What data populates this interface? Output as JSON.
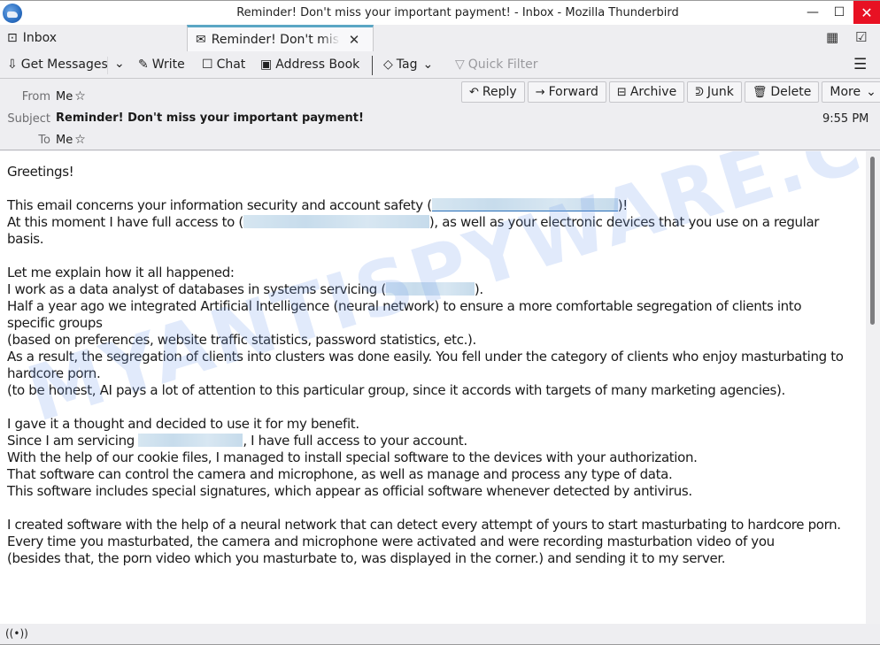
{
  "window": {
    "title": "Reminder! Don't miss your important payment! - Inbox - Mozilla Thunderbird",
    "minimize_icon": "—",
    "maximize_icon": "☐",
    "close_icon": "✕"
  },
  "tabs": [
    {
      "label": "Inbox",
      "icon": "inbox-icon",
      "glyph": "⊡",
      "active": false
    },
    {
      "label": "Reminder! Don't miss your important payment!",
      "icon": "envelope-icon",
      "glyph": "✉",
      "active": true,
      "close_glyph": "✕"
    }
  ],
  "tabbar_right": {
    "calendar_glyph": "▦",
    "tasks_glyph": "☑"
  },
  "toolbar": {
    "get_messages": "Get Messages",
    "get_messages_glyph": "⇩",
    "dropdown_glyph": "⌄",
    "write": "Write",
    "write_glyph": "✎",
    "chat": "Chat",
    "chat_glyph": "☐",
    "address_book": "Address Book",
    "address_book_glyph": "▣",
    "tag": "Tag",
    "tag_glyph": "◇",
    "quick_filter": "Quick Filter",
    "quick_filter_glyph": "▽",
    "menu_glyph": "☰"
  },
  "header": {
    "from_label": "From",
    "from_value": "Me",
    "subject_label": "Subject",
    "subject_value": "Reminder! Don't miss your important payment!",
    "to_label": "To",
    "to_value": "Me",
    "star_glyph": "☆",
    "time": "9:55 PM",
    "buttons": {
      "reply": "Reply",
      "reply_glyph": "↶",
      "forward": "Forward",
      "forward_glyph": "→",
      "archive": "Archive",
      "archive_glyph": "⊟",
      "junk": "Junk",
      "junk_glyph": "ᕲ",
      "delete": "Delete",
      "delete_glyph": "🗑",
      "more": "More",
      "more_glyph": "⌄"
    }
  },
  "message": {
    "greeting": "Greetings!",
    "p1_a": "This email concerns your information security and account safety (",
    "p1_b": ")!",
    "p2_a": "At this moment I have full access to (",
    "p2_b": "), as well as your electronic devices that you use on a regular basis.",
    "p3": "Let me explain how it all happened:",
    "p4_a": "I work as a data analyst of databases in systems servicing (",
    "p4_b": ").",
    "p5": "Half a year ago we integrated Artificial Intelligence (neural network) to ensure a more comfortable segregation of clients into specific groups",
    "p6": "(based on preferences, website traffic statistics, password statistics, etc.).",
    "p7": "As a result, the segregation of clients into clusters was done easily. You fell under the category of clients who enjoy masturbating to hardcore porn.",
    "p8": "(to be honest, AI pays a lot of attention to this particular group, since it accords with targets of many marketing agencies).",
    "p9": "I gave it a thought and decided to use it for my benefit.",
    "p10_a": "Since I am servicing ",
    "p10_b": ", I have full access to your account.",
    "p11": "With the help of our cookie files, I managed to install special software to the devices with your authorization.",
    "p12": "That software can control the camera and microphone, as well as manage and process any type of data.",
    "p13": "This software includes special signatures, which appear as official software whenever detected by antivirus.",
    "p14": "I created software with the help of a neural network that can detect every attempt of yours to start masturbating to hardcore porn.",
    "p15": "Every time you masturbated, the camera and microphone were activated and were recording masturbation video of you",
    "p16": "(besides that, the porn video which you masturbate to, was displayed in the corner.) and sending it to my server."
  },
  "watermark": "MYANTISPYWARE.COM",
  "statusbar": {
    "online_glyph": "((•))"
  },
  "colors": {
    "close_button": "#e81123",
    "active_tab_accent": "#5aa6c4",
    "link_underline": "#2a6fb8"
  }
}
